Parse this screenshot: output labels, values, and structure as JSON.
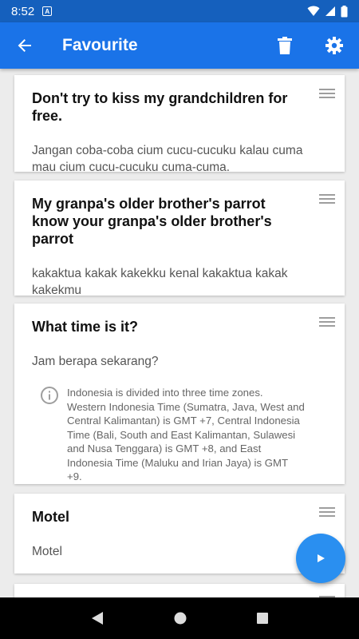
{
  "status_bar": {
    "time": "8:52",
    "notification_label": "A"
  },
  "app_bar": {
    "title": "Favourite"
  },
  "cards": [
    {
      "english": "Don't try to kiss my grandchildren for free.",
      "indonesian": "Jangan coba-coba cium cucu-cucuku kalau cuma mau cium cucu-cucuku cuma-cuma."
    },
    {
      "english": "My granpa's older brother's parrot know your granpa's older brother's parrot",
      "indonesian": "kakaktua kakak kakekku kenal kakaktua kakak kakekmu"
    },
    {
      "english": "What time is it?",
      "indonesian": "Jam berapa sekarang?",
      "note": "Indonesia is divided into three time zones. Western Indonesia Time (Sumatra, Java, West and Central Kalimantan) is GMT +7, Central Indonesia Time (Bali, South and East Kalimantan, Sulawesi and Nusa Tenggara) is GMT +8, and East Indonesia Time (Maluku and Irian Jaya) is GMT +9."
    },
    {
      "english": "Motel",
      "indonesian": "Motel"
    }
  ],
  "colors": {
    "app_bar": "#1a73e8",
    "status_bar": "#1560bd",
    "fab": "#2a8ff0",
    "background": "#ececec"
  },
  "icons": [
    "back-arrow-icon",
    "trash-icon",
    "settings-gear-icon",
    "drag-handle-icon",
    "info-icon",
    "play-icon"
  ]
}
